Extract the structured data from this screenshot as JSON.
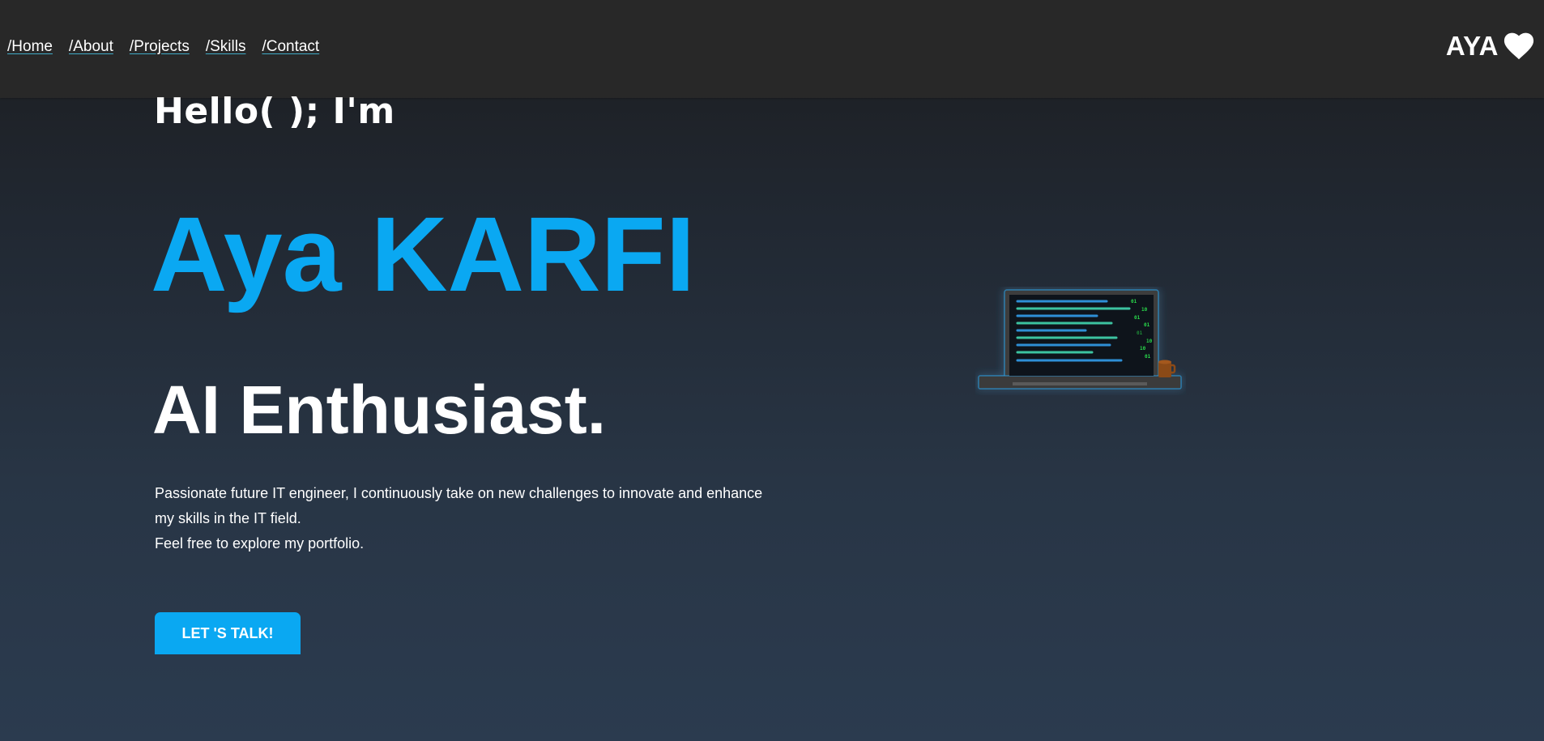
{
  "nav": {
    "links": [
      "/Home",
      "/About",
      "/Projects",
      "/Skills",
      "/Contact"
    ]
  },
  "brand": {
    "name": "AYA",
    "icon": "heart-icon"
  },
  "hero": {
    "greeting": "Hello( ); I'm",
    "name": "Aya KARFI",
    "role": "AI Enthusiast.",
    "bio_lines": [
      "Passionate future IT engineer, I continuously take on new challenges to innovate and enhance my skills in the IT field.",
      "Feel free to explore my portfolio."
    ],
    "cta_label": "LET 'S TALK!"
  },
  "illustration": {
    "icon": "laptop-code-icon",
    "binary": [
      "01",
      "10",
      "01",
      "01",
      "01",
      "10",
      "10",
      "01"
    ]
  },
  "colors": {
    "accent": "#0aa8f2",
    "navbar": "#282828",
    "text": "#ffffff"
  }
}
